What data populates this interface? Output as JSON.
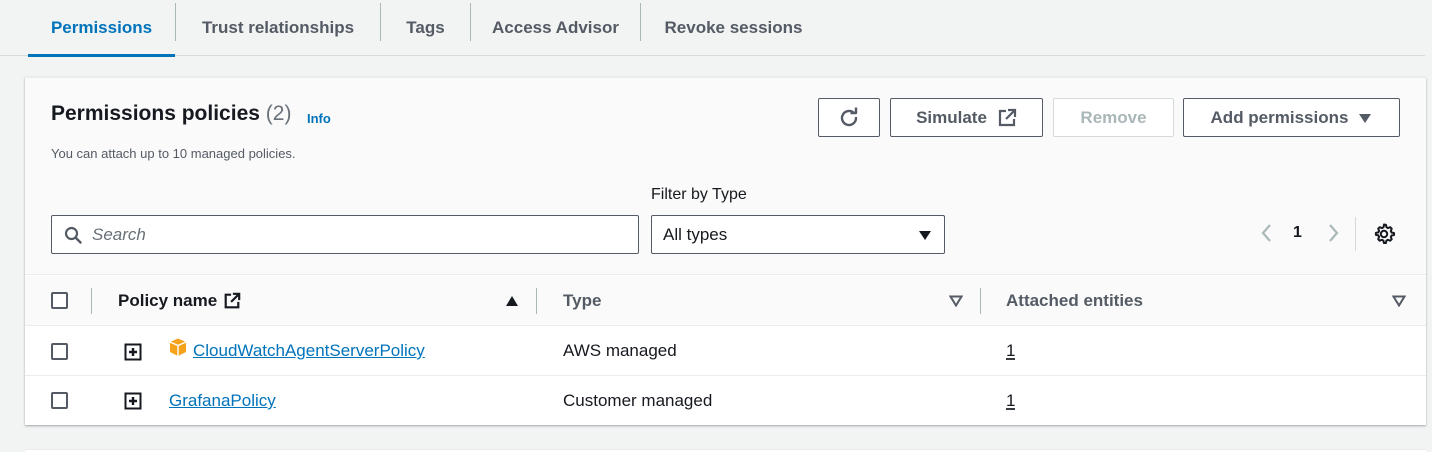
{
  "tabs": [
    {
      "label": "Permissions",
      "active": true
    },
    {
      "label": "Trust relationships"
    },
    {
      "label": "Tags"
    },
    {
      "label": "Access Advisor"
    },
    {
      "label": "Revoke sessions"
    }
  ],
  "panel": {
    "title": "Permissions policies",
    "count": "(2)",
    "info_label": "Info",
    "subtitle": "You can attach up to 10 managed policies."
  },
  "actions": {
    "refresh_icon": "refresh-icon",
    "simulate_label": "Simulate",
    "remove_label": "Remove",
    "add_permissions_label": "Add permissions"
  },
  "filter": {
    "search_placeholder": "Search",
    "type_label": "Filter by Type",
    "type_value": "All types"
  },
  "pagination": {
    "current_page": "1"
  },
  "table": {
    "columns": {
      "policy_name": "Policy name",
      "type": "Type",
      "attached": "Attached entities"
    },
    "rows": [
      {
        "name": "CloudWatchAgentServerPolicy",
        "aws_icon": true,
        "type": "AWS managed",
        "attached": "1"
      },
      {
        "name": "GrafanaPolicy",
        "aws_icon": false,
        "type": "Customer managed",
        "attached": "1"
      }
    ]
  },
  "colors": {
    "accent": "#0073bb",
    "aws_orange": "#f7a21b",
    "text": "#16191f",
    "muted": "#545b64"
  }
}
